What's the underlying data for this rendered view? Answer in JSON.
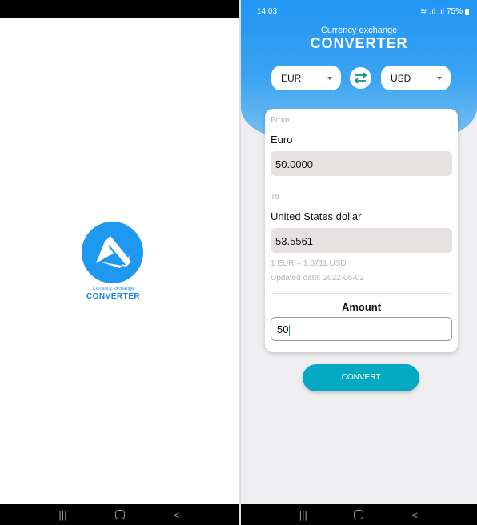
{
  "splash": {
    "logo_subtitle": "Currency exchange",
    "logo_title": "CONVERTER"
  },
  "status_bar": {
    "time": "14:03",
    "battery": "75%"
  },
  "header": {
    "subtitle": "Currency exchange",
    "title": "CONVERTER"
  },
  "currency_selector": {
    "from": "EUR",
    "to": "USD"
  },
  "card": {
    "from_label": "From",
    "from_currency": "Euro",
    "from_value": "50.0000",
    "to_label": "To",
    "to_currency": "United States dollar",
    "to_value": "53.5561",
    "rate_text": "1 EUR =  1.0711 USD",
    "updated_text": "Updated date: 2022-06-02",
    "amount_label": "Amount",
    "amount_value": "50"
  },
  "convert_button": "CONVERT",
  "nav": {
    "recents": "|||",
    "back": "<"
  },
  "colors": {
    "primary_blue": "#2196f3",
    "button_teal": "#05a9c3",
    "value_box": "#e6e2e2"
  }
}
